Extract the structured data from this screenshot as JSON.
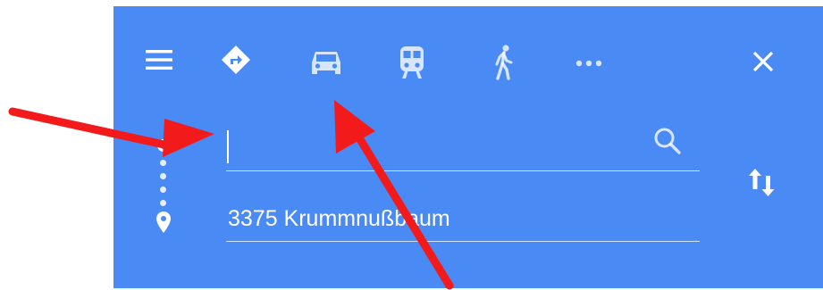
{
  "directions": {
    "modes": [
      {
        "id": "best",
        "icon": "directions-diamond-icon",
        "selected": true
      },
      {
        "id": "driving",
        "icon": "car-icon",
        "selected": false
      },
      {
        "id": "transit",
        "icon": "train-icon",
        "selected": false
      },
      {
        "id": "walking",
        "icon": "walking-icon",
        "selected": false
      },
      {
        "id": "more",
        "icon": "more-dots-icon",
        "selected": false
      }
    ],
    "starting_point": {
      "value": "",
      "placeholder": ""
    },
    "destination": {
      "value": "3375 Krummnußbaum"
    }
  },
  "colors": {
    "panel": "#4a8af4",
    "icon": "#ffffff",
    "annotation_arrow": "#f21a1a"
  }
}
